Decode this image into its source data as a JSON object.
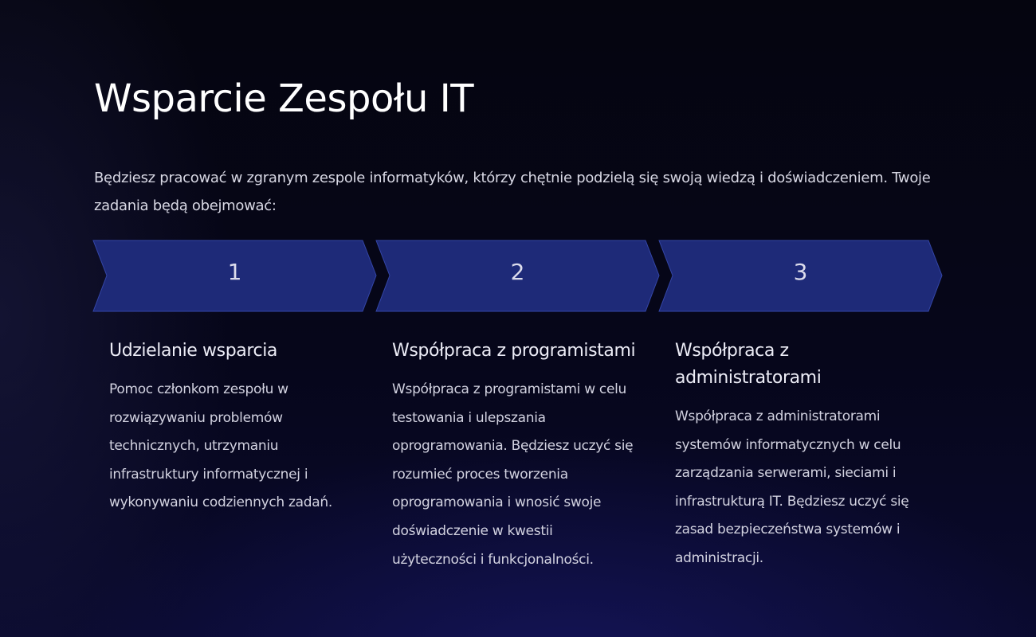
{
  "title": "Wsparcie Zespołu IT",
  "intro": "Będziesz pracować w zgranym zespole informatyków, którzy chętnie podzielą się swoją wiedzą i doświadczeniem. Twoje zadania będą obejmować:",
  "colors": {
    "chevron_fill": "#1e2a78",
    "chevron_stroke": "#3446a8",
    "background": "#05050f"
  },
  "steps": [
    {
      "number": "1",
      "title": "Udzielanie wsparcia",
      "description": "Pomoc członkom zespołu w rozwiązywaniu problemów technicznych, utrzymaniu infrastruktury informatycznej i wykonywaniu codziennych zadań."
    },
    {
      "number": "2",
      "title": "Współpraca z programistami",
      "description": "Współpraca z programistami w celu testowania i ulepszania oprogramowania. Będziesz uczyć się rozumieć proces tworzenia oprogramowania i wnosić swoje doświadczenie w kwestii użyteczności i funkcjonalności."
    },
    {
      "number": "3",
      "title": "Współpraca z administratorami",
      "description": "Współpraca z administratorami systemów informatycznych w celu zarządzania serwerami, sieciami i infrastrukturą IT. Będziesz uczyć się zasad bezpieczeństwa systemów i administracji."
    }
  ]
}
